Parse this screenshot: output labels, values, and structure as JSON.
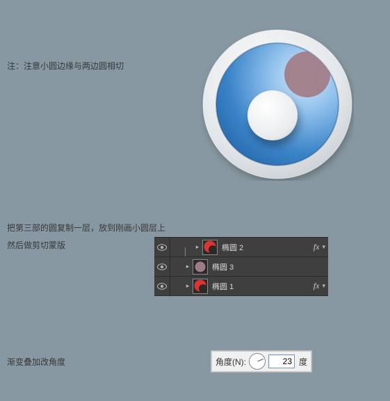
{
  "note_top": "注：注意小圆边缘与两边圆相切",
  "instruction_1": "把第三部的圆复制一层，放到刚画小圆层上",
  "instruction_2": "然后做剪切蒙版",
  "layers": {
    "row0": {
      "name": "椭圆 2"
    },
    "row1": {
      "name": "椭圆 3"
    },
    "row2": {
      "name": "椭圆 1"
    }
  },
  "angle": {
    "section_label": "渐变叠加改角度",
    "label": "角度(N):",
    "value": "23",
    "unit": "度"
  }
}
